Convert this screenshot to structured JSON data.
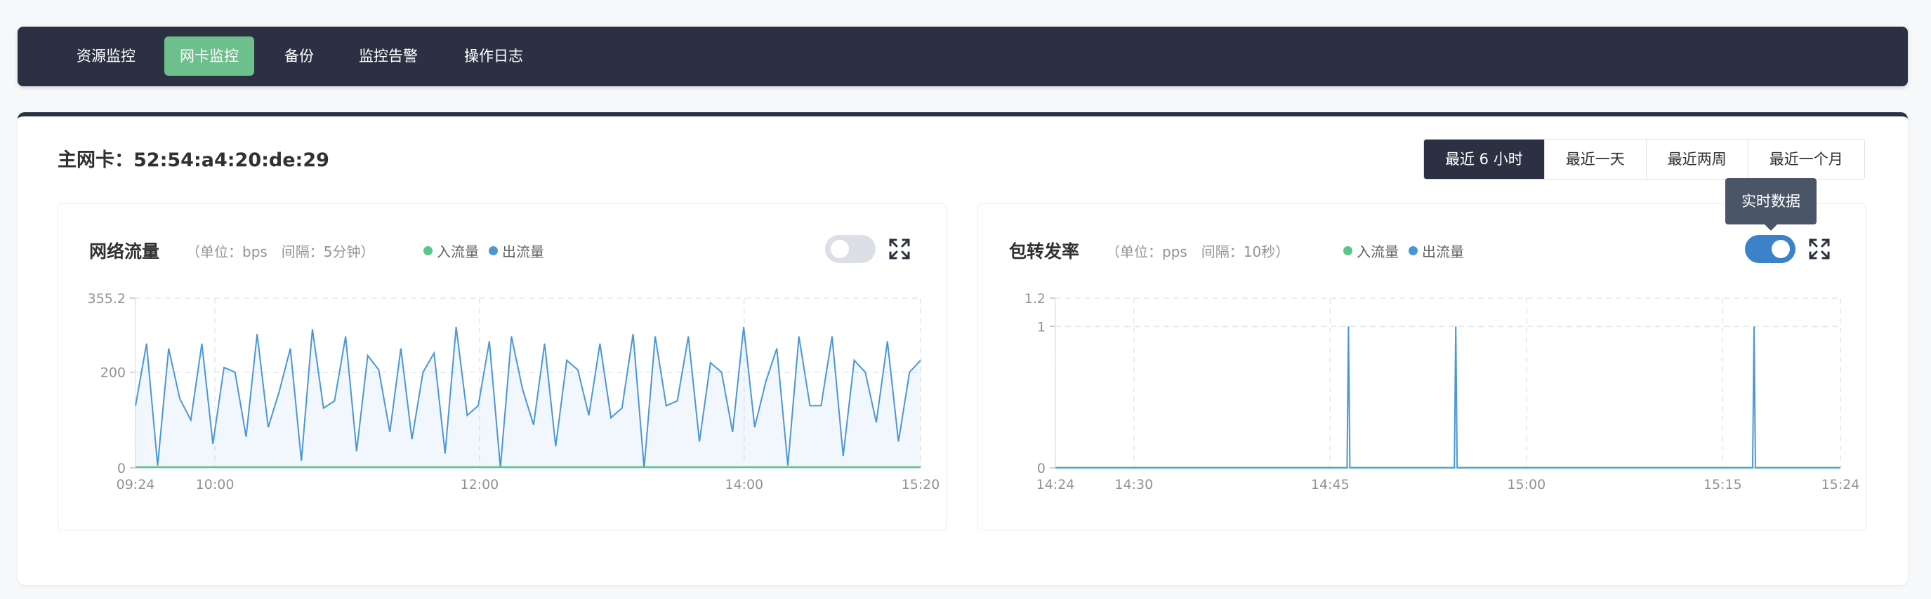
{
  "nav": {
    "items": [
      {
        "label": "资源监控",
        "active": false
      },
      {
        "label": "网卡监控",
        "active": true
      },
      {
        "label": "备份",
        "active": false
      },
      {
        "label": "监控告警",
        "active": false
      },
      {
        "label": "操作日志",
        "active": false
      }
    ]
  },
  "nic": {
    "title": "主网卡：52:54:a4:20:de:29"
  },
  "ranges": [
    {
      "label": "最近 6 小时",
      "active": true
    },
    {
      "label": "最近一天",
      "active": false
    },
    {
      "label": "最近两周",
      "active": false
    },
    {
      "label": "最近一个月",
      "active": false
    }
  ],
  "tooltip": "实时数据",
  "colors": {
    "in": "#5cc58a",
    "out": "#4a97d6",
    "nav_bg": "#2b3142",
    "nav_active": "#6dbf8b"
  },
  "charts": {
    "traffic": {
      "title": "网络流量",
      "unit": "（单位：bps　间隔：5分钟）",
      "legend_in": "入流量",
      "legend_out": "出流量",
      "realtime_on": false,
      "expand_icon": "expand-icon"
    },
    "packets": {
      "title": "包转发率",
      "unit": "（单位：pps　间隔：10秒）",
      "legend_in": "入流量",
      "legend_out": "出流量",
      "realtime_on": true,
      "expand_icon": "expand-icon"
    }
  },
  "chart_data": [
    {
      "type": "area",
      "title": "网络流量",
      "x_start": "09:24",
      "x_end": "15:20",
      "x_tick_labels": [
        "09:24",
        "10:00",
        "12:00",
        "14:00",
        "15:20"
      ],
      "x_tick_minutes": [
        564,
        600,
        720,
        840,
        920
      ],
      "x_range_minutes": [
        564,
        920
      ],
      "y_ticks": [
        0,
        200,
        355.2
      ],
      "ylim": [
        0,
        355.2
      ],
      "grid": true,
      "series": [
        {
          "name": "出流量",
          "color": "#4a97d6",
          "values": [
            130,
            260,
            5,
            250,
            145,
            100,
            260,
            50,
            210,
            200,
            65,
            280,
            85,
            160,
            250,
            15,
            290,
            125,
            140,
            275,
            35,
            235,
            205,
            75,
            250,
            60,
            200,
            240,
            30,
            295,
            110,
            130,
            265,
            0,
            275,
            165,
            90,
            260,
            45,
            225,
            205,
            110,
            260,
            105,
            125,
            280,
            0,
            275,
            130,
            140,
            275,
            55,
            220,
            200,
            75,
            295,
            85,
            180,
            250,
            5,
            275,
            130,
            130,
            275,
            25,
            225,
            200,
            95,
            265,
            55,
            200,
            225
          ]
        },
        {
          "name": "入流量",
          "color": "#5cc58a",
          "values": [
            0,
            0
          ]
        }
      ]
    },
    {
      "type": "line",
      "title": "包转发率",
      "x_start": "14:24",
      "x_end": "15:24",
      "x_tick_labels": [
        "14:24",
        "14:30",
        "14:45",
        "15:00",
        "15:15",
        "15:24"
      ],
      "x_tick_minutes": [
        864,
        870,
        885,
        900,
        915,
        924
      ],
      "x_range_minutes": [
        864,
        924
      ],
      "y_ticks": [
        0,
        1,
        1.2
      ],
      "ylim": [
        0,
        1.2
      ],
      "grid": true,
      "series": [
        {
          "name": "出流量",
          "color": "#4a97d6",
          "spikes_minutes": [
            886.4,
            894.6,
            917.4
          ],
          "spike_value": 1,
          "base_value": 0
        },
        {
          "name": "入流量",
          "color": "#5cc58a",
          "spikes_minutes": [],
          "spike_value": 0,
          "base_value": 0
        }
      ]
    }
  ]
}
